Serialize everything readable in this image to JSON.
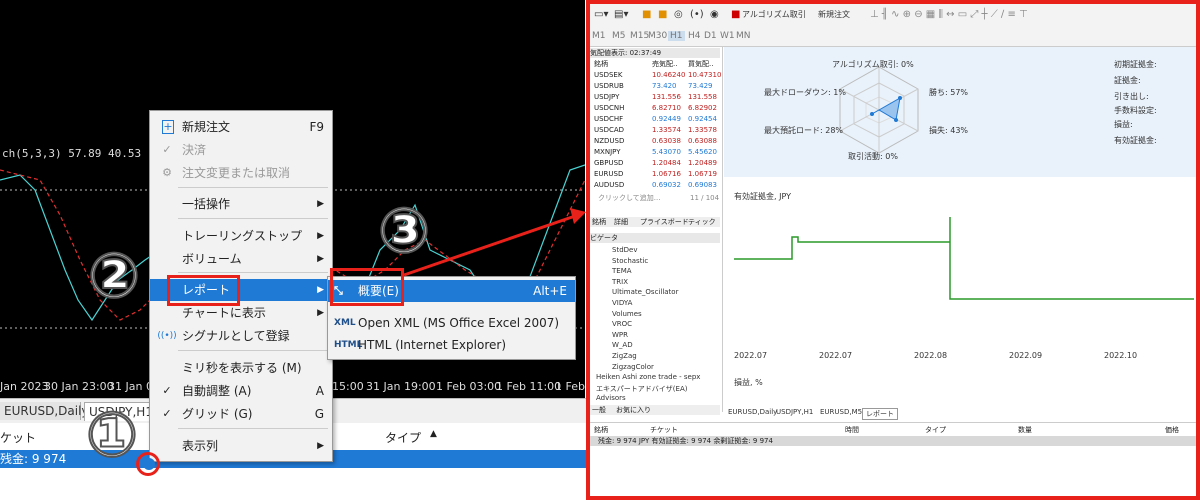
{
  "chart": {
    "indicator_label": "ch(5,3,3) 57.89 40.53",
    "time_labels": [
      "Jan 2023",
      "30 Jan 23:00",
      "31 Jan 03",
      "15:00",
      "31 Jan 19:00",
      "1 Feb 03:00",
      "1 Feb 11:00",
      "1 Feb"
    ]
  },
  "bottom_tabs": [
    "EURUSD,Daily",
    "USDJPY,H1"
  ],
  "bottom_header": {
    "col1": "ケット",
    "col2": "タイプ",
    "sort_icon": "▲"
  },
  "bottom_bar": {
    "text": "残金: 9 974"
  },
  "context_menu": {
    "items": [
      {
        "label": "新規注文",
        "shortcut": "F9",
        "icon": "new-order-icon"
      },
      {
        "label": "決済",
        "icon": "check-icon",
        "disabled": true
      },
      {
        "label": "注文変更または取消",
        "icon": "gear-icon",
        "disabled": true
      },
      {
        "label": "一括操作",
        "submenu": true
      },
      {
        "label": "トレーリングストップ",
        "submenu": true
      },
      {
        "label": "ボリューム",
        "submenu": true
      },
      {
        "label": "レポート",
        "submenu": true,
        "selected": true
      },
      {
        "label": "チャートに表示",
        "submenu": true
      },
      {
        "label": "シグナルとして登録",
        "icon": "signal-icon"
      },
      {
        "label": "ミリ秒を表示する (M)"
      },
      {
        "label": "自動調整 (A)",
        "shortcut": "A",
        "checked": true
      },
      {
        "label": "グリッド (G)",
        "shortcut": "G",
        "checked": true
      },
      {
        "label": "表示列",
        "submenu": true
      }
    ]
  },
  "submenu": {
    "items": [
      {
        "label": "概要(E)",
        "shortcut": "Alt+E",
        "icon": "report-icon",
        "selected": true
      },
      {
        "label": "Open XML (MS Office Excel 2007)",
        "icon": "XML"
      },
      {
        "label": "HTML (Internet Explorer)",
        "icon": "HTML"
      }
    ]
  },
  "annotations": {
    "step1": "①",
    "step2": "②",
    "step3": "③"
  },
  "right_panel": {
    "toolbar": {
      "algo_label": "アルゴリズム取引",
      "new_order_label": "新規注文"
    },
    "timeframes": [
      "M1",
      "M5",
      "M15",
      "M30",
      "H1",
      "H4",
      "D1",
      "W1",
      "MN"
    ],
    "market_watch": {
      "title": "気配値表示: 02:37:49",
      "headers": [
        "銘柄",
        "売気配..",
        "買気配.."
      ],
      "rows": [
        [
          "USDSEK",
          "10.46240",
          "10.47310"
        ],
        [
          "USDRUB",
          "73.420",
          "73.429"
        ],
        [
          "USDJPY",
          "131.556",
          "131.558"
        ],
        [
          "USDCNH",
          "6.82710",
          "6.82902"
        ],
        [
          "USDCHF",
          "0.92449",
          "0.92454"
        ],
        [
          "USDCAD",
          "1.33574",
          "1.33578"
        ],
        [
          "NZDUSD",
          "0.63038",
          "0.63088"
        ],
        [
          "MXNJPY",
          "5.43070",
          "5.45620"
        ],
        [
          "GBPUSD",
          "1.20484",
          "1.20489"
        ],
        [
          "EURUSD",
          "1.06716",
          "1.06719"
        ],
        [
          "AUDUSD",
          "0.69032",
          "0.69083"
        ]
      ],
      "footer": "クリックして追加...",
      "count": "11 / 104",
      "tabs": [
        "銘柄",
        "詳細",
        "プライスボード",
        "ティック"
      ]
    },
    "navigator": {
      "title": "ビゲータ",
      "items": [
        "StdDev",
        "Stochastic",
        "TEMA",
        "TRIX",
        "Ultimate_Oscillator",
        "VIDYA",
        "Volumes",
        "VROC",
        "WPR",
        "W_AD",
        "ZigZag",
        "ZigzagColor",
        "Heiken Ashi zone trade - sepx",
        "エキスパートアドバイザ(EA)",
        "Advisors"
      ],
      "tabs": [
        "一般",
        "お気に入り"
      ]
    },
    "stats": {
      "radar_labels": [
        "アルゴリズム取引: 0%",
        "最大ドローダウン: 1%",
        "最大預託ロード: 28%",
        "取引活動: 0%",
        "損失: 43%",
        "勝ち: 57%"
      ],
      "right_labels": [
        "初期証拠金:",
        "証拠金:",
        "引き出し:",
        "手数料設定:",
        "損益:",
        "有効証拠金:"
      ]
    },
    "graph": {
      "title": "有効証拠金, JPY",
      "x_labels": [
        "2022.07",
        "2022.07",
        "2022.08",
        "2022.09",
        "2022.10"
      ],
      "bottom_label": "損益, %"
    },
    "chart_tabs": [
      "EURUSD,Daily",
      "USDJPY,H1",
      "EURUSD,M5",
      "レポート"
    ],
    "bottom_table": {
      "headers": [
        "銘柄",
        "チケット",
        "時間",
        "タイプ",
        "数量",
        "価格"
      ],
      "summary": "残金: 9 974 JPY  有効証拠金: 9 974  余剰証拠金: 9 974"
    }
  },
  "colors": {
    "accent": "#1f7ad6",
    "annotation": "#e8221a",
    "profit_line": "#2a9a2a"
  }
}
